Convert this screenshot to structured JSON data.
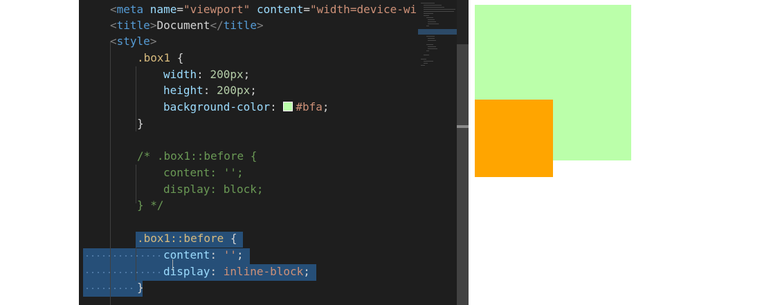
{
  "code_lines": [
    "<meta name=\"viewport\" content=\"width=device-wi",
    "<title>Document</title>",
    "<style>",
    ".box1 {",
    "width: 200px;",
    "height: 200px;",
    "background-color: #bfa;",
    "}",
    "/* .box1::before {",
    "content: '';",
    "display: block;",
    "} */",
    ".box1::before {",
    "content: '';",
    "display: inline-block;",
    "}"
  ],
  "tokens": {
    "meta_open": "<",
    "meta_tag": "meta",
    "meta_name_attr": " name",
    "meta_eq1": "=",
    "meta_name_val": "\"viewport\"",
    "meta_content_attr": " content",
    "meta_eq2": "=",
    "meta_content_val": "\"width=device-wi",
    "title_open_lt": "<",
    "title_tag1": "title",
    "title_open_gt": ">",
    "title_text": "Document",
    "title_close_lt": "</",
    "title_tag2": "title",
    "title_close_gt": ">",
    "style_lt": "<",
    "style_tag": "style",
    "style_gt": ">",
    "box1_selector": ".box1",
    "brace_open": " {",
    "width_prop": "width",
    "colon": ": ",
    "width_val": "200px",
    "semicolon": ";",
    "height_prop": "height",
    "height_val": "200px",
    "bg_prop": "background-color",
    "bg_val": "#bfa",
    "brace_close": "}",
    "comment_1": "/* .box1::before {",
    "comment_2": "content: '';",
    "comment_3": "display: block;",
    "comment_4": "} */",
    "before_selector": ".box1::before",
    "content_prop": "content",
    "content_val": "''",
    "display_prop": "display",
    "display_val": "inline-block"
  },
  "colors": {
    "editor_bg": "#1e1e1e",
    "selection": "#264f78",
    "box1": "#bbffaa",
    "box1_before": "#ffa500"
  },
  "preview": {
    "box1_color": "#bbffaa",
    "before_color": "#ffa500"
  }
}
